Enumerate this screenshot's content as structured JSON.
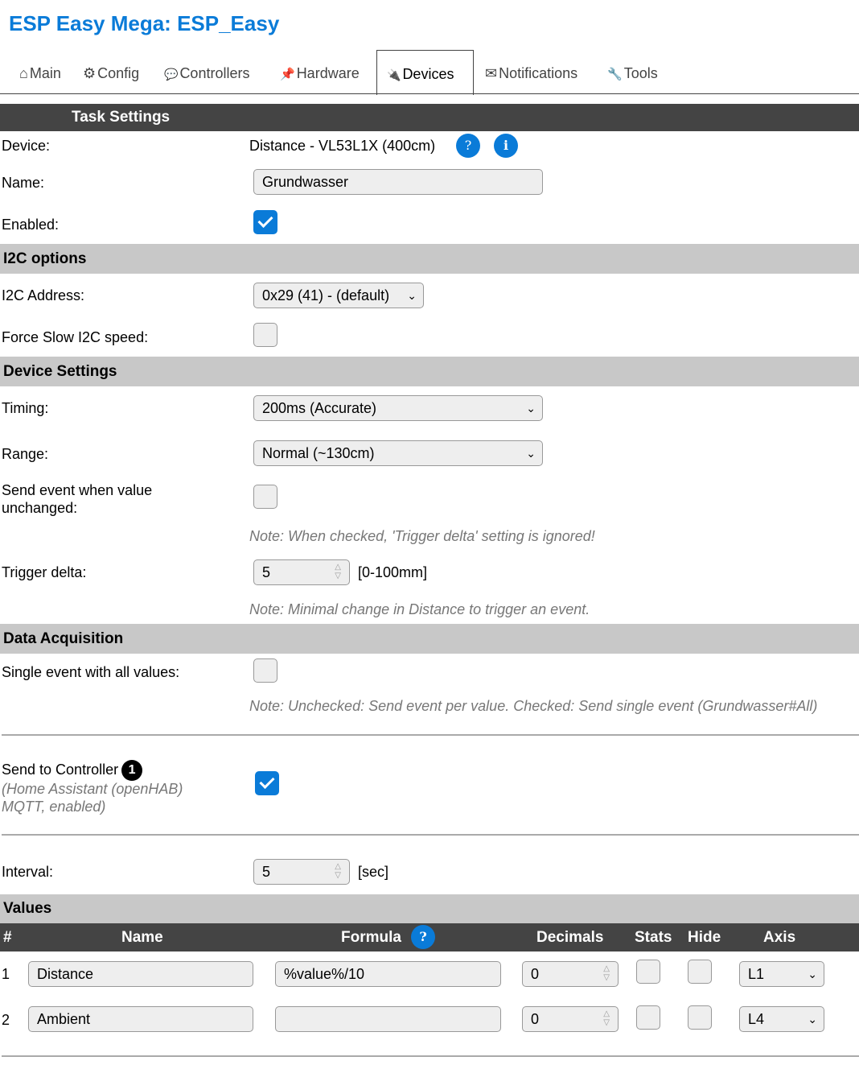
{
  "app": {
    "title": "ESP Easy Mega: ESP_Easy"
  },
  "tabs": [
    {
      "label": "Main",
      "icon": "⌂"
    },
    {
      "label": "Config",
      "icon": "⚙"
    },
    {
      "label": "Controllers",
      "icon": "💬"
    },
    {
      "label": "Hardware",
      "icon": "📌"
    },
    {
      "label": "Devices",
      "icon": "🔌"
    },
    {
      "label": "Notifications",
      "icon": "✉"
    },
    {
      "label": "Tools",
      "icon": "🔧"
    }
  ],
  "task": {
    "header": "Task Settings",
    "device_label": "Device:",
    "device_value": "Distance - VL53L1X (400cm)",
    "help_glyph": "?",
    "info_glyph": "i",
    "name_label": "Name:",
    "name_value": "Grundwasser",
    "enabled_label": "Enabled:",
    "enabled": true
  },
  "i2c": {
    "header": "I2C options",
    "address_label": "I2C Address:",
    "address_value": "0x29 (41) - (default)",
    "slow_label": "Force Slow I2C speed:",
    "slow": false
  },
  "device_settings": {
    "header": "Device Settings",
    "timing_label": "Timing:",
    "timing_value": "200ms (Accurate)",
    "range_label": "Range:",
    "range_value": "Normal (~130cm)",
    "unchanged_label_1": "Send event when value",
    "unchanged_label_2": "unchanged:",
    "unchanged": false,
    "unchanged_note": "Note: When checked, 'Trigger delta' setting is ignored!",
    "delta_label": "Trigger delta:",
    "delta_value": "5",
    "delta_unit": "[0-100mm]",
    "delta_note": "Note: Minimal change in Distance to trigger an event."
  },
  "acquisition": {
    "header": "Data Acquisition",
    "single_label": "Single event with all values:",
    "single": false,
    "single_note": "Note: Unchecked: Send event per value. Checked: Send single event (Grundwasser#All)",
    "controller_label": "Send to Controller",
    "controller_badge": "1",
    "controller_sub_1": "(Home Assistant (openHAB)",
    "controller_sub_2": "MQTT, enabled)",
    "controller_enabled": true,
    "interval_label": "Interval:",
    "interval_value": "5",
    "interval_unit": "[sec]"
  },
  "values": {
    "header": "Values",
    "columns": {
      "num": "#",
      "name": "Name",
      "formula": "Formula",
      "decimals": "Decimals",
      "stats": "Stats",
      "hide": "Hide",
      "axis": "Axis"
    },
    "rows": [
      {
        "num": "1",
        "name": "Distance",
        "formula": "%value%/10",
        "decimals": "0",
        "stats": false,
        "hide": false,
        "axis": "L1"
      },
      {
        "num": "2",
        "name": "Ambient",
        "formula": "",
        "decimals": "0",
        "stats": false,
        "hide": false,
        "axis": "L4"
      }
    ]
  },
  "colors": {
    "accent": "#0a7bd8",
    "dark_header": "#444444",
    "grey_header": "#c8c8c8"
  }
}
